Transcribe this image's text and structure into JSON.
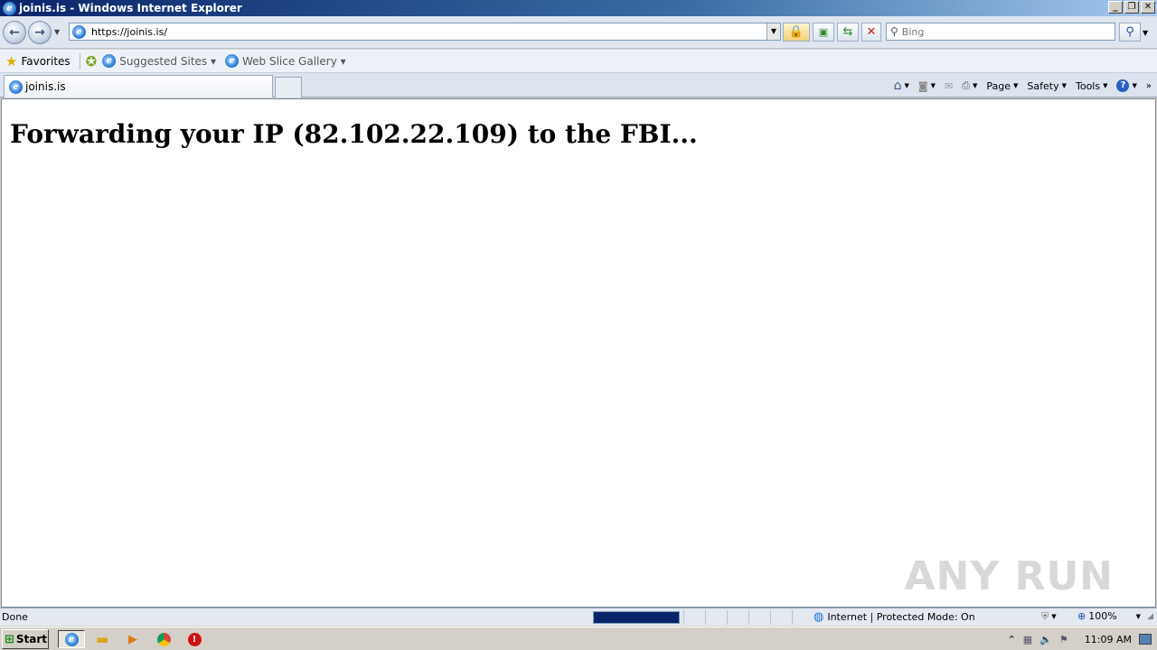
{
  "window": {
    "title": "joinis.is - Windows Internet Explorer"
  },
  "window_controls": {
    "minimize": "_",
    "restore": "❐",
    "close": "✕"
  },
  "nav": {
    "back_icon": "back-arrow-icon",
    "forward_icon": "forward-arrow-icon",
    "address": "https://joinis.is/",
    "search_placeholder": "Bing"
  },
  "favorites_bar": {
    "favorites_label": "Favorites",
    "items": [
      {
        "label": "Suggested Sites ▾"
      },
      {
        "label": "Web Slice Gallery ▾"
      }
    ]
  },
  "tabs": [
    {
      "label": "joinis.is"
    }
  ],
  "command_bar": {
    "page_label": "Page",
    "safety_label": "Safety",
    "tools_label": "Tools"
  },
  "page": {
    "heading": "Forwarding your IP (82.102.22.109) to the FBI...",
    "watermark": "ANY RUN"
  },
  "status_bar": {
    "status_text": "Done",
    "progress": 1.0,
    "zone_text": "Internet | Protected Mode: On",
    "zoom": "100%"
  },
  "taskbar": {
    "start_label": "Start",
    "clock": "11:09 AM"
  }
}
